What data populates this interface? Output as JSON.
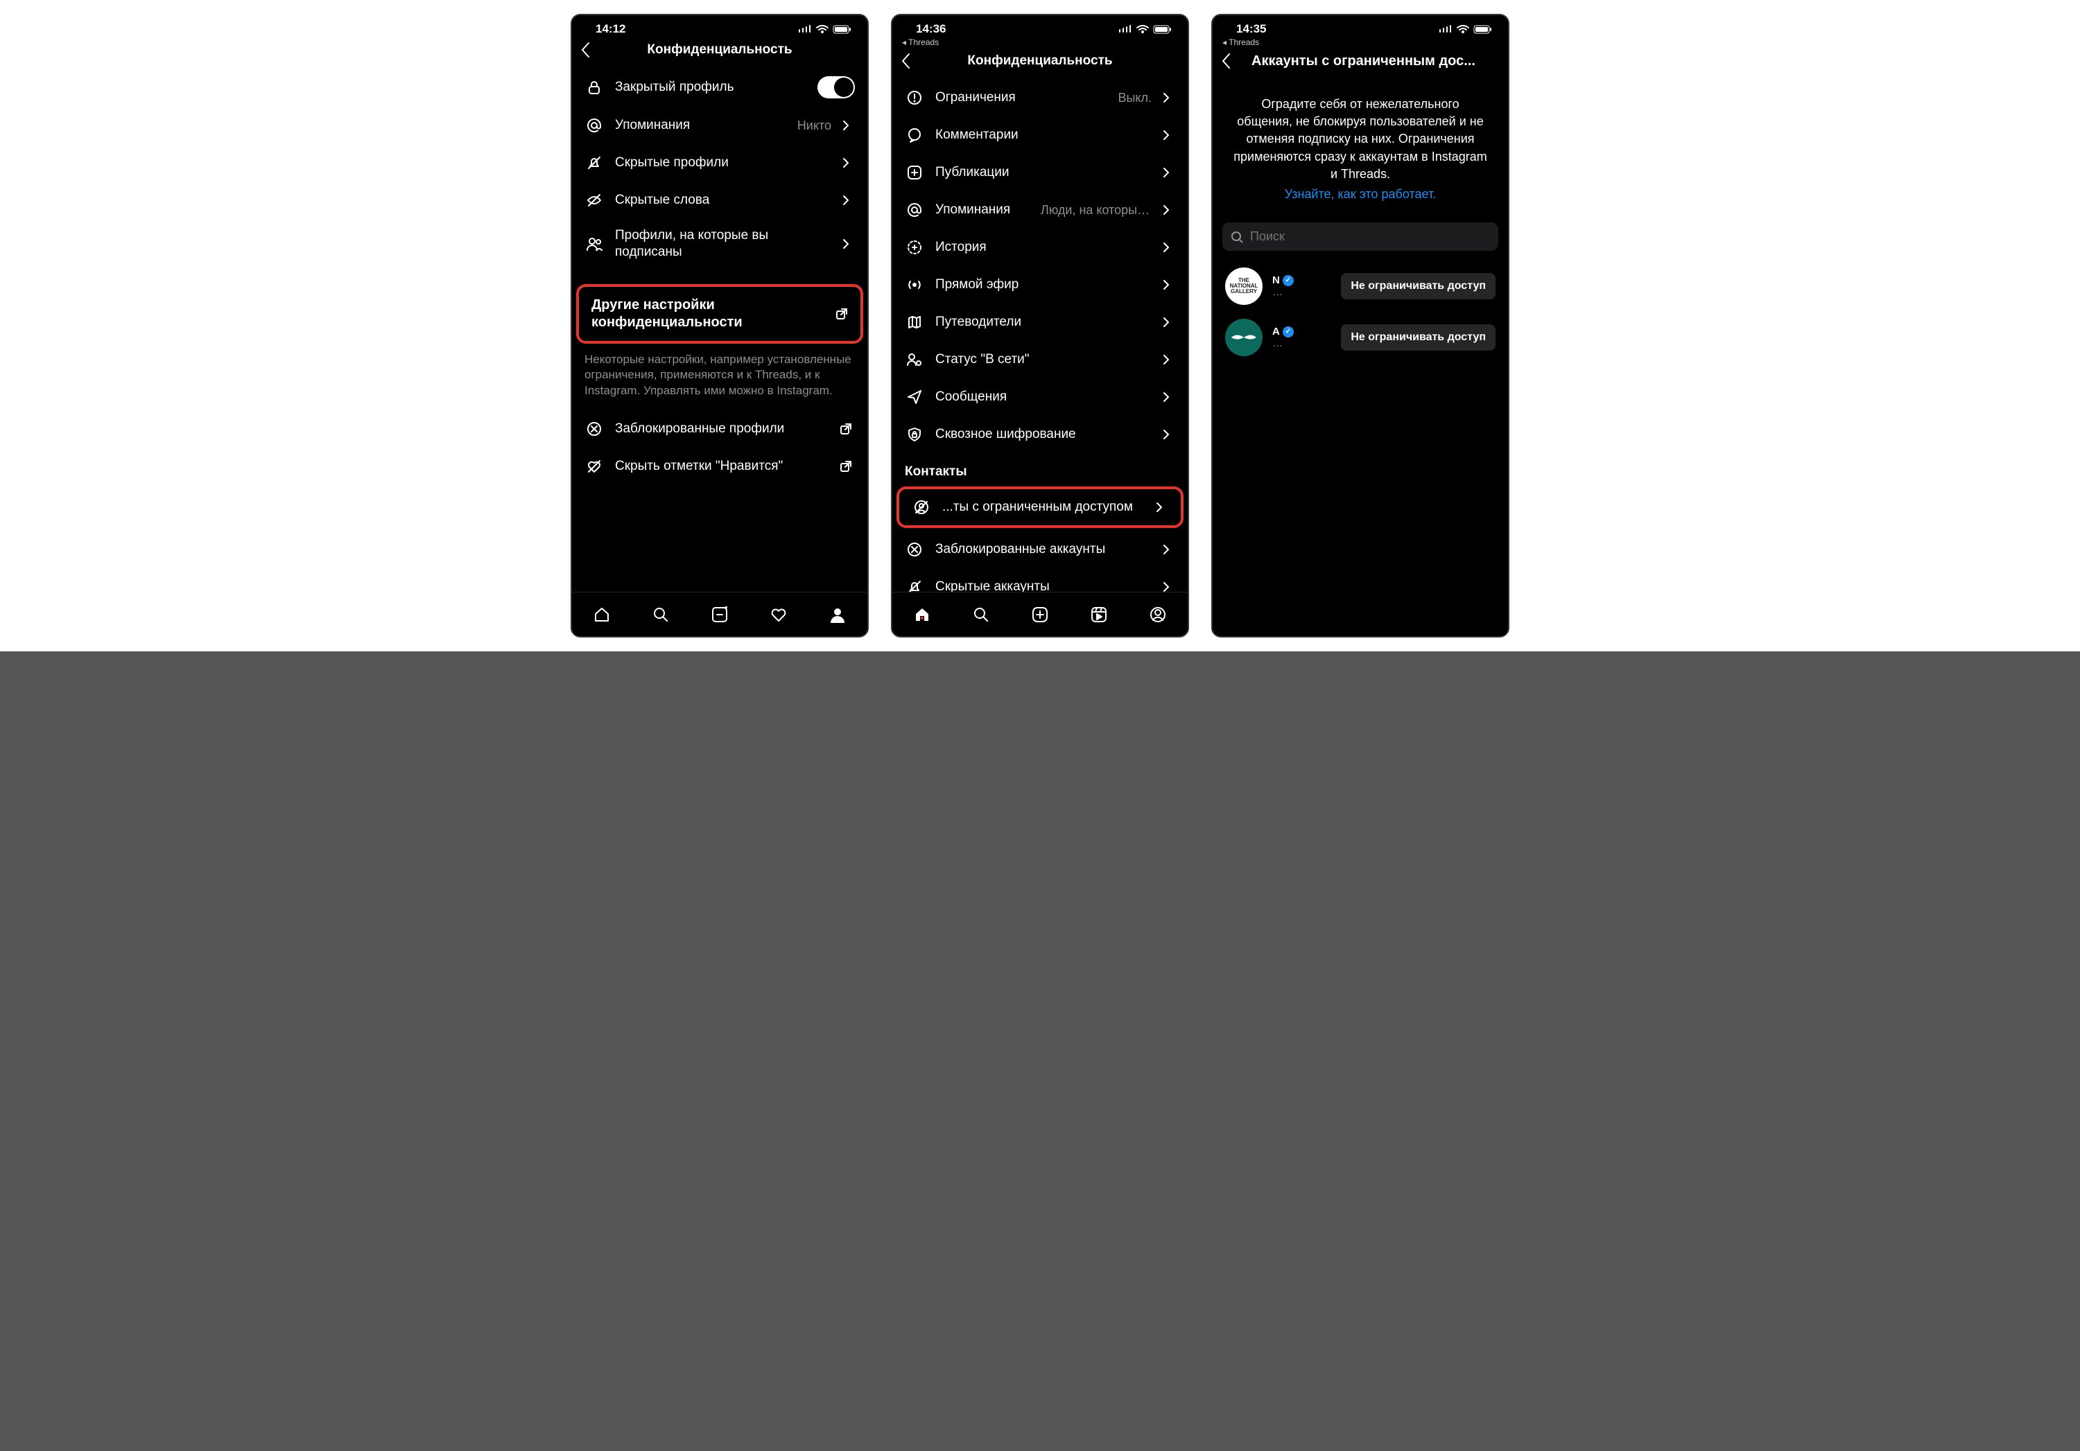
{
  "screen1": {
    "status": {
      "time": "14:12"
    },
    "title": "Конфиденциальность",
    "rows": {
      "private": "Закрытый профиль",
      "mentions": "Упоминания",
      "mentions_value": "Никто",
      "hidden_profiles": "Скрытые профили",
      "hidden_words": "Скрытые слова",
      "followed": "Профили, на которые вы подписаны",
      "other_settings": "Другие настройки конфиденциальности",
      "note": "Некоторые настройки, например установленные ограничения, применяются и к Threads, и к Instagram. Управлять ими можно в Instagram.",
      "blocked": "Заблокированные профили",
      "hide_likes": "Скрыть отметки \"Нравится\""
    }
  },
  "screen2": {
    "status": {
      "time": "14:36",
      "back_app": "◂ Threads"
    },
    "title": "Конфиденциальность",
    "rows": {
      "limits": "Ограничения",
      "limits_value": "Выкл.",
      "comments": "Комментарии",
      "posts": "Публикации",
      "mentions": "Упоминания",
      "mentions_value": "Люди, на которых...",
      "story": "История",
      "live": "Прямой эфир",
      "guides": "Путеводители",
      "activity": "Статус \"В сети\"",
      "messages": "Сообщения",
      "e2e": "Сквозное шифрование",
      "section_contacts": "Контакты",
      "restricted": "...ты с ограниченным доступом",
      "blocked": "Заблокированные аккаунты",
      "hidden": "Скрытые аккаунты"
    }
  },
  "screen3": {
    "status": {
      "time": "14:35",
      "back_app": "◂ Threads"
    },
    "title": "Аккаунты с ограниченным дос...",
    "description": "Оградите себя от нежелательного общения, не блокируя пользователей и не отменяя подписку на них. Ограничения применяются сразу к аккаунтам в Instagram и Threads.",
    "link": "Узнайте, как это работает.",
    "search_placeholder": "Поиск",
    "accounts": [
      {
        "avatar_label": "THE NATIONAL GALLERY",
        "name_initial": "N",
        "more": "…",
        "button": "Не ограничивать доступ"
      },
      {
        "avatar_label": "",
        "name_initial": "A",
        "more": "…",
        "button": "Не ограничивать доступ"
      }
    ]
  }
}
